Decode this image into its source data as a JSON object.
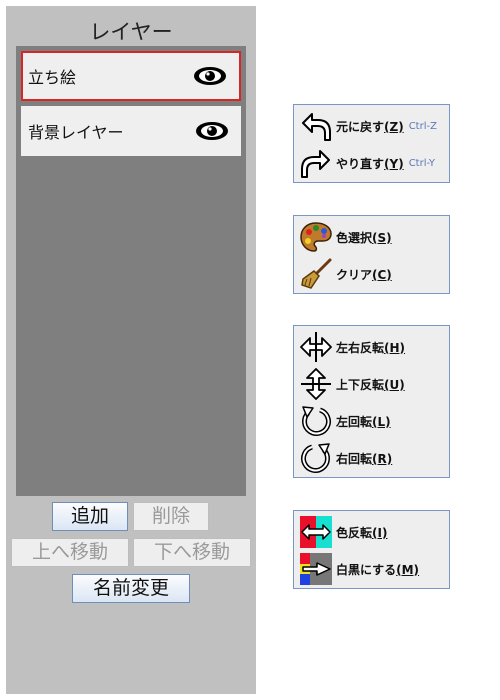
{
  "layers_panel": {
    "title": "レイヤー",
    "layers": [
      {
        "name": "立ち絵",
        "visible": true,
        "selected": true
      },
      {
        "name": "背景レイヤー",
        "visible": true,
        "selected": false
      }
    ],
    "buttons": {
      "add": "追加",
      "delete": "削除",
      "move_up": "上へ移動",
      "move_down": "下へ移動",
      "rename": "名前変更"
    }
  },
  "history": {
    "undo": {
      "label": "元に戻す",
      "key": "(Z)",
      "shortcut": "Ctrl-Z",
      "icon": "undo-arrow-icon"
    },
    "redo": {
      "label": "やり直す",
      "key": "(Y)",
      "shortcut": "Ctrl-Y",
      "icon": "redo-arrow-icon"
    }
  },
  "color_tools": {
    "select_color": {
      "label": "色選択",
      "key": "(S)",
      "icon": "palette-icon"
    },
    "clear": {
      "label": "クリア",
      "key": "(C)",
      "icon": "broom-icon"
    }
  },
  "transform_tools": {
    "flip_h": {
      "label": "左右反転",
      "key": "(H)",
      "icon": "flip-horizontal-icon"
    },
    "flip_v": {
      "label": "上下反転",
      "key": "(U)",
      "icon": "flip-vertical-icon"
    },
    "rotate_left": {
      "label": "左回転",
      "key": "(L)",
      "icon": "rotate-left-icon"
    },
    "rotate_right": {
      "label": "右回転",
      "key": "(R)",
      "icon": "rotate-right-icon"
    }
  },
  "filter_tools": {
    "invert": {
      "label": "色反転",
      "key": "(I)",
      "icon": "invert-colors-icon"
    },
    "grayscale": {
      "label": "白黒にする",
      "key": "(M)",
      "icon": "grayscale-icon"
    }
  },
  "colors": {
    "panel_bg": "#c0c0c0",
    "list_bg": "#7f7f7f",
    "selected_border": "#d82626",
    "group_border": "#7a95c6",
    "shortcut_text": "#5a78b8"
  }
}
